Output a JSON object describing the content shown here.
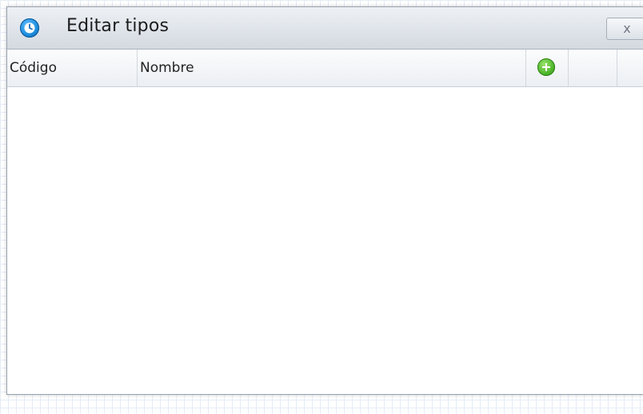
{
  "dialog": {
    "title": "Editar tipos",
    "title_icon": "clock-icon",
    "close_label": "x",
    "accent_color": "#1f8fe0"
  },
  "grid": {
    "columns": [
      {
        "label": "Código"
      },
      {
        "label": "Nombre"
      },
      {
        "label": "",
        "icon": "add-icon",
        "icon_color": "#4cb52a"
      },
      {
        "label": ""
      },
      {
        "label": ""
      }
    ],
    "rows": []
  }
}
